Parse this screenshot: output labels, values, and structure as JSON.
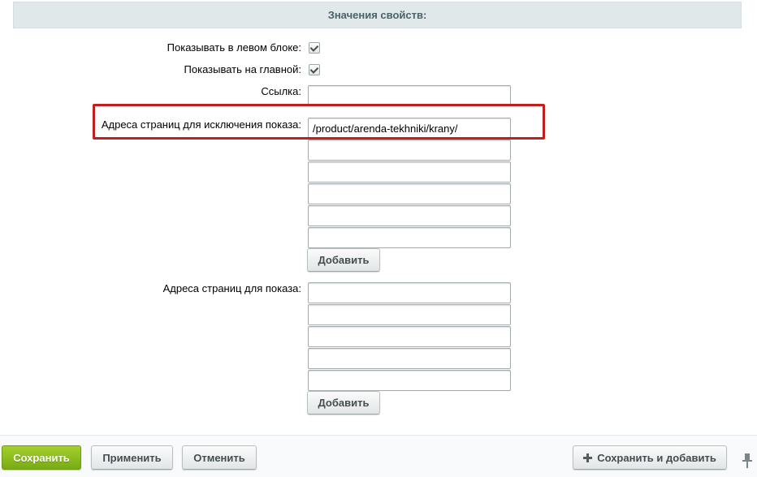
{
  "section": {
    "title": "Значения свойств:"
  },
  "fields": {
    "show_left": {
      "label": "Показывать в левом блоке:",
      "checked": true
    },
    "show_main": {
      "label": "Показывать на главной:",
      "checked": true
    },
    "link": {
      "label": "Ссылка:",
      "value": ""
    },
    "exclude_pages": {
      "label": "Адреса страниц для исключения показа:",
      "values": [
        "/product/arenda-tekhniki/krany/",
        "",
        "",
        "",
        "",
        ""
      ],
      "add_label": "Добавить"
    },
    "show_pages": {
      "label": "Адреса страниц для показа:",
      "values": [
        "",
        "",
        "",
        "",
        ""
      ],
      "add_label": "Добавить"
    }
  },
  "footer": {
    "save_label": "Сохранить",
    "apply_label": "Применить",
    "cancel_label": "Отменить",
    "save_add_label": "Сохранить и добавить"
  },
  "colors": {
    "highlight": "#c0211f",
    "save_button": "#8bbd1f",
    "header_bg": "#e0e8ea"
  }
}
